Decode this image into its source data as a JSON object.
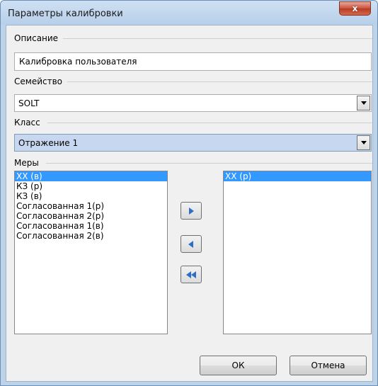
{
  "window": {
    "title": "Параметры калибровки",
    "close_glyph": "x"
  },
  "description": {
    "label": "Описание",
    "value": "Калибровка пользователя"
  },
  "family": {
    "label": "Семейство",
    "value": "SOLT"
  },
  "class": {
    "label": "Класс",
    "value": "Отражение 1"
  },
  "measures": {
    "label": "Меры",
    "available": [
      "XX (в)",
      "КЗ (р)",
      "КЗ (в)",
      "Согласованная 1(р)",
      "Согласованная 2(р)",
      "Согласованная 1(в)",
      "Согласованная 2(в)"
    ],
    "available_selected_index": 0,
    "selected": [
      "XX (р)"
    ],
    "selected_selected_index": 0
  },
  "buttons": {
    "ok": "ОК",
    "cancel": "Отмена"
  },
  "icons": {
    "move_right": "triangle-right-icon",
    "move_left": "triangle-left-icon",
    "move_all_left": "double-triangle-left-icon"
  },
  "colors": {
    "accent_blue": "#3399ff",
    "arrow_blue": "#2d6fc6",
    "class_combo_bg": "#c7d7ef"
  }
}
